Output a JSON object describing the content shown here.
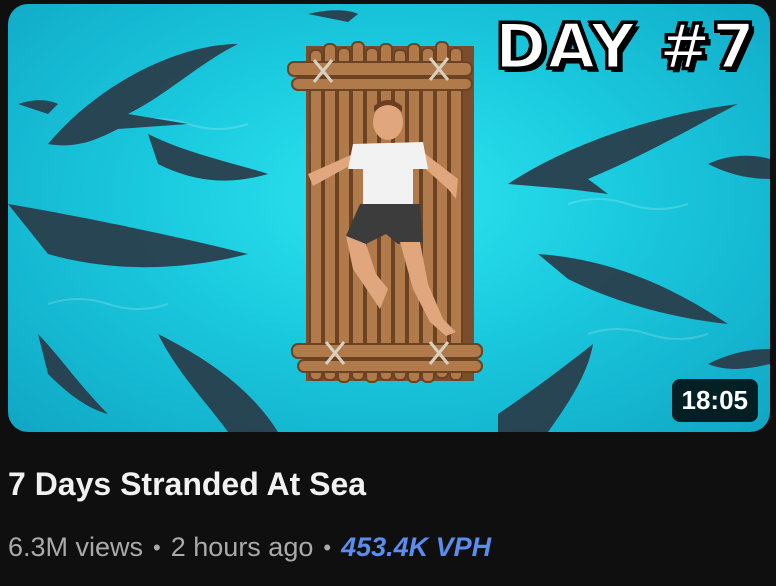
{
  "video": {
    "overlay_text": "DAY #7",
    "duration": "18:05",
    "title": "7 Days Stranded At Sea",
    "views": "6.3M views",
    "separator": "•",
    "age": "2 hours ago",
    "vph": "453.4K VPH"
  },
  "colors": {
    "background": "#0f0f0f",
    "water": "#1ac9de",
    "vph_accent": "#5a8dee",
    "meta_text": "#aaaaaa"
  }
}
